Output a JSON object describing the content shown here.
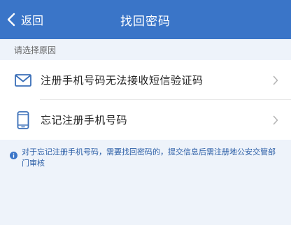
{
  "navbar": {
    "back_label": "返回",
    "title": "找回密码",
    "background": "#3a75c8"
  },
  "section": {
    "header": "请选择原因"
  },
  "options": [
    {
      "label": "注册手机号码无法接收短信验证码",
      "icon": "envelope-icon"
    },
    {
      "label": "忘记注册手机号码",
      "icon": "mobile-phone-icon"
    }
  ],
  "notice": {
    "icon": "info-icon",
    "text": "对于忘记注册手机号码，需要找回密码的，提交信息后需注册地公安交管部门审核"
  },
  "colors": {
    "accent": "#3a75c8",
    "page_bg": "#eef3fa",
    "notice_text": "#2b5ea6"
  }
}
